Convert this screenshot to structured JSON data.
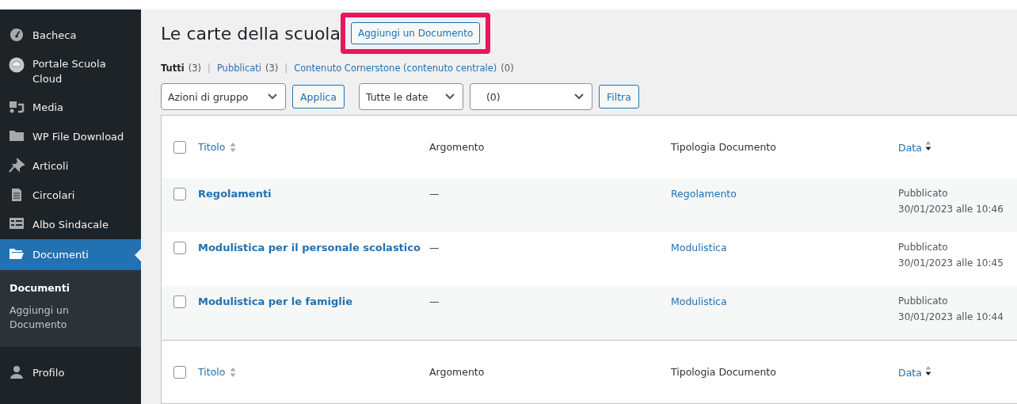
{
  "sidebar": {
    "items": [
      {
        "label": "Bacheca",
        "selected": false
      },
      {
        "label": "Portale Scuola Cloud",
        "selected": false
      },
      {
        "label": "Media",
        "selected": false
      },
      {
        "label": "WP File Download",
        "selected": false
      },
      {
        "label": "Articoli",
        "selected": false
      },
      {
        "label": "Circolari",
        "selected": false
      },
      {
        "label": "Albo Sindacale",
        "selected": false
      },
      {
        "label": "Documenti",
        "selected": true,
        "submenu": [
          {
            "label": "Documenti",
            "selected": true
          },
          {
            "label": "Aggiungi un Documento",
            "selected": false
          }
        ]
      },
      {
        "label": "Profilo",
        "selected": false
      }
    ]
  },
  "page": {
    "title": "Le carte della scuola",
    "add_button": "Aggiungi un Documento",
    "highlighted": true
  },
  "views": [
    {
      "label": "Tutti",
      "count": "(3)",
      "selected": true
    },
    {
      "separator": "|",
      "label": "Pubblicati",
      "count": "(3)",
      "selected": false
    },
    {
      "separator": "|",
      "label": "Contenuto Cornerstone (contenuto centrale)",
      "count": "(0)",
      "selected": false
    }
  ],
  "filters": {
    "bulk_action": "Azioni di gruppo",
    "apply": "Applica",
    "date": "Tutte le date",
    "category": "(0)",
    "filter": "Filtra"
  },
  "table": {
    "header_checked": false,
    "columns": [
      {
        "label": "Titolo",
        "sortable": true
      },
      {
        "label": "Argomento",
        "sortable": false
      },
      {
        "label": "Tipologia Documento",
        "sortable": false
      },
      {
        "label": "Data",
        "sortable": true
      }
    ],
    "footer_checked": false,
    "footer_columns": [
      {
        "label": "Titolo",
        "sortable": true
      },
      {
        "label": "Argomento",
        "sortable": false
      },
      {
        "label": "Tipologia Documento",
        "sortable": false
      },
      {
        "label": "Data",
        "sortable": true
      }
    ],
    "rows": [
      {
        "checked": false,
        "title": "Regolamenti",
        "topic": "—",
        "type": "Regolamento",
        "status": "Pubblicato",
        "date": "30/01/2023 alle 10:46"
      },
      {
        "checked": false,
        "title": "Modulistica per il personale scolastico",
        "topic": "—",
        "type": "Modulistica",
        "status": "Pubblicato",
        "date": "30/01/2023 alle 10:45"
      },
      {
        "checked": false,
        "title": "Modulistica per le famiglie",
        "topic": "—",
        "type": "Modulistica",
        "status": "Pubblicato",
        "date": "30/01/2023 alle 10:44"
      }
    ]
  }
}
